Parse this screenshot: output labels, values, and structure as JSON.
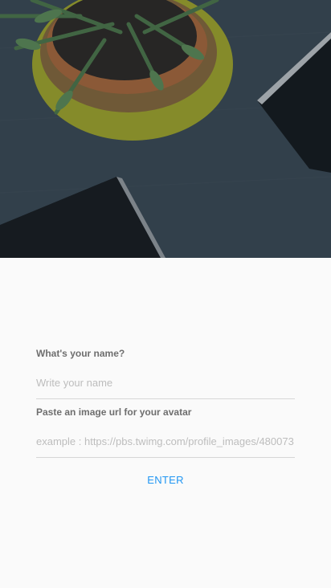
{
  "login": {
    "name_label": "What's your name?",
    "name_placeholder": "Write your name",
    "name_value": "",
    "avatar_label": "Paste an image url for your avatar",
    "avatar_placeholder": "example : https://pbs.twimg.com/profile_images/480073",
    "avatar_value": "",
    "enter_label": "ENTER"
  },
  "colors": {
    "accent": "#2196f3",
    "background": "#fafafa",
    "label": "#6e6e6e",
    "placeholder": "#bdbdbd"
  }
}
